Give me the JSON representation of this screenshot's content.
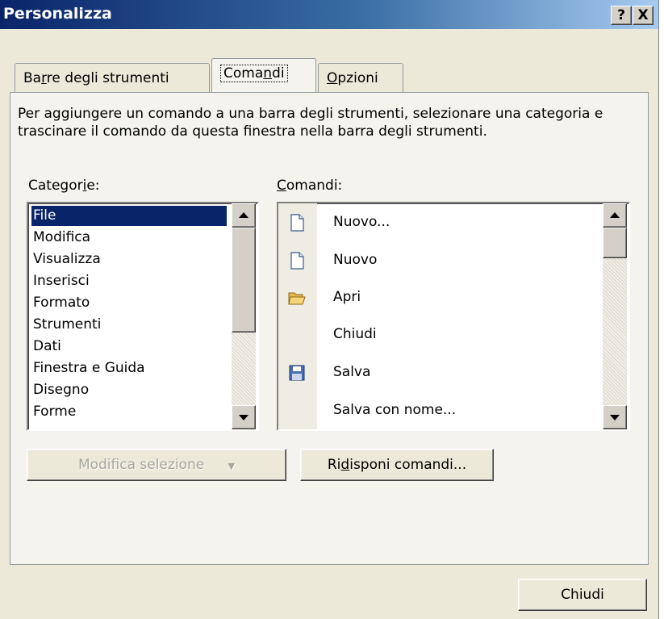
{
  "window": {
    "title": "Personalizza",
    "help_button": "?",
    "close_button": "X"
  },
  "tabs": [
    {
      "pre": "Ba",
      "key": "r",
      "post": "re degli strumenti"
    },
    {
      "pre": "Coma",
      "key": "n",
      "post": "di"
    },
    {
      "pre": "",
      "key": "O",
      "post": "pzioni"
    }
  ],
  "description": "Per aggiungere un comando a una barra degli strumenti, selezionare una categoria e trascinare il comando da questa finestra nella barra degli strumenti.",
  "categories_label": {
    "pre": "Categor",
    "key": "i",
    "post": "e:"
  },
  "commands_label": {
    "pre": "",
    "key": "C",
    "post": "omandi:"
  },
  "categories": [
    "File",
    "Modifica",
    "Visualizza",
    "Inserisci",
    "Formato",
    "Strumenti",
    "Dati",
    "Finestra e Guida",
    "Disegno",
    "Forme"
  ],
  "selected_category": "File",
  "commands": [
    {
      "label": "Nuovo...",
      "icon": "new-document-icon"
    },
    {
      "label": "Nuovo",
      "icon": "new-document-icon"
    },
    {
      "label": "Apri",
      "icon": "open-folder-icon"
    },
    {
      "label": "Chiudi",
      "icon": ""
    },
    {
      "label": "Salva",
      "icon": "save-disk-icon"
    },
    {
      "label": "Salva con nome...",
      "icon": ""
    }
  ],
  "buttons": {
    "modify_selection": "Modifica selezione",
    "rearrange": {
      "pre": "Ri",
      "key": "d",
      "post": "isponi comandi..."
    },
    "close": "Chiudi"
  },
  "colors": {
    "selection": "#0a246a",
    "titlebar_start": "#0a246a",
    "face": "#ece9d8"
  }
}
